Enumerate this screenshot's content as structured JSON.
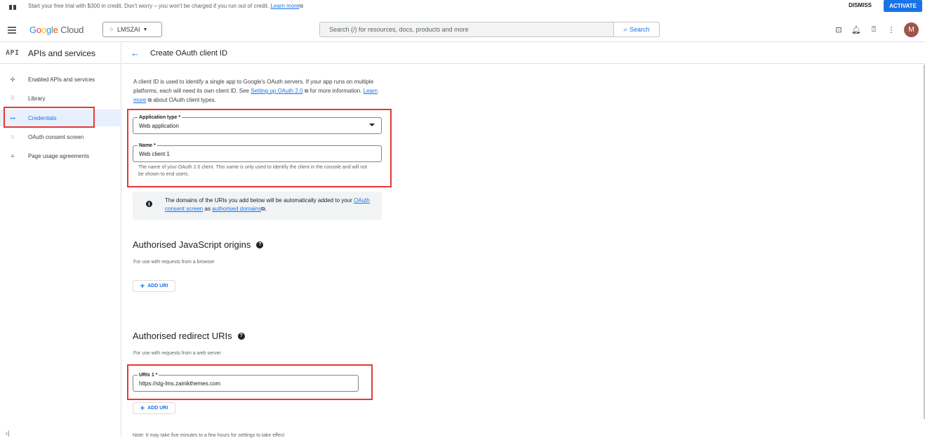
{
  "banner": {
    "text": "Start your free trial with $300 in credit. Don't worry – you won't be charged if you run out of credit.",
    "link": "Learn more",
    "dismiss": "DISMISS",
    "activate": "ACTIVATE"
  },
  "topbar": {
    "logo_g": [
      "Go",
      "o",
      "g",
      "le"
    ],
    "logo_cloud": "Cloud",
    "project": "LMSZAI",
    "search_placeholder": "Search (/) for resources, docs, products and more",
    "search_button": "Search",
    "avatar_initial": "M"
  },
  "sidebar": {
    "badge": "API",
    "title": "APIs and services",
    "items": [
      {
        "label": "Enabled APIs and services",
        "icon": "enabled-apis-icon"
      },
      {
        "label": "Library",
        "icon": "library-icon"
      },
      {
        "label": "Credentials",
        "icon": "key-icon"
      },
      {
        "label": "OAuth consent screen",
        "icon": "consent-icon"
      },
      {
        "label": "Page usage agreements",
        "icon": "settings-list-icon"
      }
    ],
    "active_index": 2,
    "collapse_glyph": "‹|"
  },
  "header": {
    "back": "←",
    "title": "Create OAuth client ID"
  },
  "intro": {
    "part1": "A client ID is used to identify a single app to Google's OAuth servers. If your app runs on multiple platforms, each will need its own client ID. See ",
    "link1": "Setting up OAuth 2.0",
    "part2": " for more information. ",
    "link2": "Learn more",
    "part3": " about OAuth client types."
  },
  "form": {
    "app_type_label": "Application type *",
    "app_type_value": "Web application",
    "name_label": "Name *",
    "name_value": "Web client 1",
    "name_hint": "The name of your OAuth 2.0 client. This name is only used to identify the client in the console and will not be shown to end users."
  },
  "notice": {
    "part1": "The domains of the URIs you add below will be automatically added to your ",
    "link1": "OAuth consent screen",
    "part2": " as ",
    "link2": "authorised domains",
    "part3": "."
  },
  "js_origins": {
    "title": "Authorised JavaScript origins",
    "subtitle": "For use with requests from a browser",
    "add_label": "ADD URI"
  },
  "redirect": {
    "title": "Authorised redirect URIs",
    "subtitle": "For use with requests from a web server",
    "uri_label": "URIs 1 *",
    "uri_value": "https://stg-lms.zainikthemes.com",
    "add_label": "ADD URI"
  },
  "footnote": "Note: It may take five minutes to a few hours for settings to take effect"
}
